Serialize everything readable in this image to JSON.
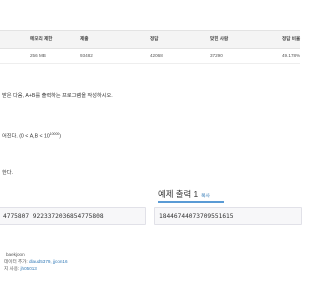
{
  "stats": {
    "headers": [
      "메모리 제한",
      "제출",
      "정답",
      "맞힌 사람",
      "정답 비율"
    ],
    "values": [
      "256 MB",
      "93482",
      "42068",
      "37290",
      "49.178%"
    ]
  },
  "description": {
    "problem_line": "받은 다음, A+B를 출력하는 프로그램을 작성하시오.",
    "input_line": "어진다. (0 < A,B < 10",
    "input_exponent": "10000",
    "input_close": ")",
    "output_line": "한다."
  },
  "sample_output": {
    "title": "예제 출력 1",
    "copy_label": "복사"
  },
  "samples": {
    "input_text": "4775807  9223372036854775808",
    "output_text": "18446744073709551615"
  },
  "footer": {
    "line1": "baekjoon",
    "line2_prefix": "데이터 추가: ",
    "line2_links": "dlaud5379, jjcon16",
    "line3_prefix": "지 사용: ",
    "line3_link": "jh05013"
  }
}
